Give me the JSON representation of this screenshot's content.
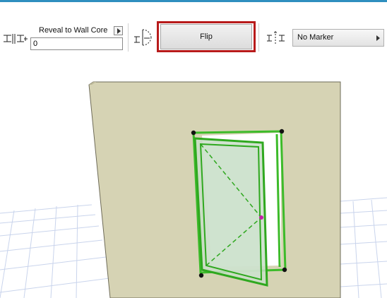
{
  "toolbar": {
    "reveal_label": "Reveal to Wall Core",
    "reveal_value": "0",
    "flip_label": "Flip",
    "marker_label": "No Marker"
  },
  "colors": {
    "accent_line": "#2f8fbf",
    "highlight": "#b81b1b",
    "wall": "#d6d3b4",
    "selection": "#3dbb2a"
  },
  "icons": [
    "reveal-offset-icon",
    "door-swing-icon",
    "marker-type-icon",
    "chevron-right-icon"
  ]
}
